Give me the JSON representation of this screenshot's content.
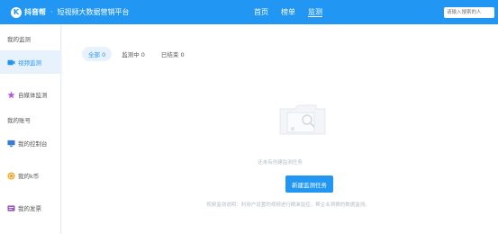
{
  "header": {
    "logo_mark": "K",
    "brand": "抖音帮",
    "separator": "·",
    "platform": "短视频大数据营销平台",
    "nav": [
      {
        "label": "首页"
      },
      {
        "label": "榜单"
      },
      {
        "label": "监测"
      }
    ],
    "search": {
      "placeholder": "请输入搜索的人"
    }
  },
  "sidebar": {
    "section_monitor": "我的监测",
    "video_monitor": "视频监测",
    "media_monitor": "自媒体监测",
    "section_account": "我的账号",
    "console": "我的控制台",
    "kcoin": "我的k币",
    "tickets": "我的发票"
  },
  "tabs": [
    {
      "label": "全部 0"
    },
    {
      "label": "监测中 0"
    },
    {
      "label": "已结束 0"
    }
  ],
  "empty": {
    "text": "还未有创建监测任务",
    "button": "新建监测任务",
    "desc": "视频监测说明：利用户设置的视频进行精准监控，帮企业洞察的数据监测。"
  },
  "colors": {
    "primary": "#2196f3",
    "active_bg": "#e8f2fd"
  }
}
